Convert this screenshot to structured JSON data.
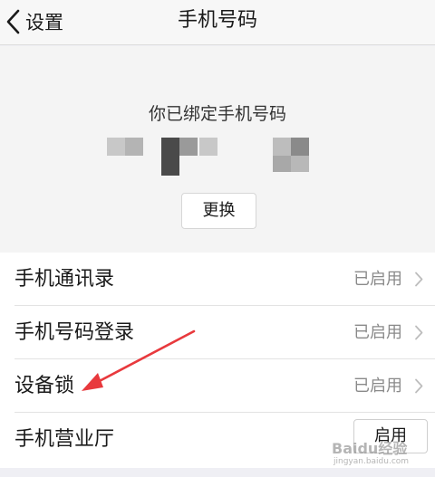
{
  "nav": {
    "back_label": "设置",
    "title": "手机号码"
  },
  "phone_panel": {
    "bound_label": "你已绑定手机号码",
    "change_label": "更换"
  },
  "settings": {
    "rows": [
      {
        "label": "手机通讯录",
        "status": "已启用"
      },
      {
        "label": "手机号码登录",
        "status": "已启用"
      },
      {
        "label": "设备锁",
        "status": "已启用"
      },
      {
        "label": "手机营业厅",
        "button": "启用"
      }
    ]
  },
  "watermark": {
    "text": "Baidu经验",
    "sub": "jingyan.baidu.com"
  },
  "colors": {
    "annotation_arrow": "#e8393d",
    "status_gray": "#8a8a8a"
  }
}
